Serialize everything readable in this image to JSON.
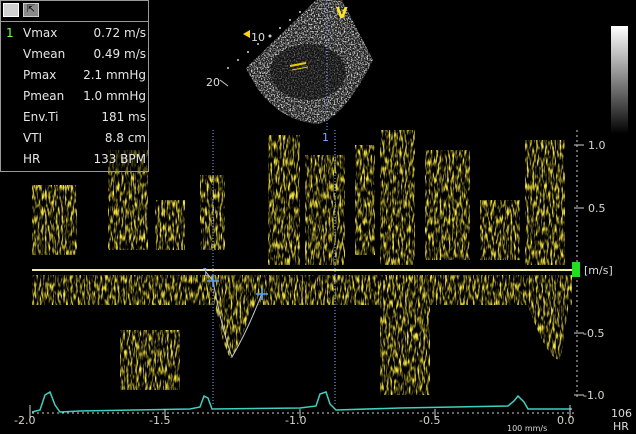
{
  "toolbar": {
    "btn2_icon": "cursor-icon",
    "btn2_glyph": "⇱"
  },
  "measurements": {
    "index": "1",
    "rows": [
      {
        "label": "Vmax",
        "value": "0.72 m/s"
      },
      {
        "label": "Vmean",
        "value": "0.49 m/s"
      },
      {
        "label": "Pmax",
        "value": "2.1 mmHg"
      },
      {
        "label": "Pmean",
        "value": "1.0 mmHg"
      },
      {
        "label": "Env.Ti",
        "value": "181 ms"
      },
      {
        "label": "VTI",
        "value": "8.8 cm"
      },
      {
        "label": "HR",
        "value": "133 BPM"
      }
    ]
  },
  "echo": {
    "view_marker": "V",
    "depth_labels": [
      "10",
      "20"
    ]
  },
  "doppler": {
    "cursor_label": "1",
    "velocity_unit": "[m/s]",
    "velocity_ticks": [
      "1.0",
      "0.5",
      "-0.5",
      "-1.0"
    ],
    "time_ticks": [
      "-2.0",
      "-1.5",
      "-1.0",
      "-0.5",
      "0.0"
    ],
    "sweep_speed": "100 mm/s",
    "hr_value": "106",
    "hr_label": "HR"
  },
  "colors": {
    "doppler": "#e6c800",
    "envelope": "#c0c0c0",
    "caliper": "#5aa0ff",
    "ecg": "#3fd0c0",
    "baseline": "#f0f0a0",
    "indicator": "#22dd22"
  }
}
